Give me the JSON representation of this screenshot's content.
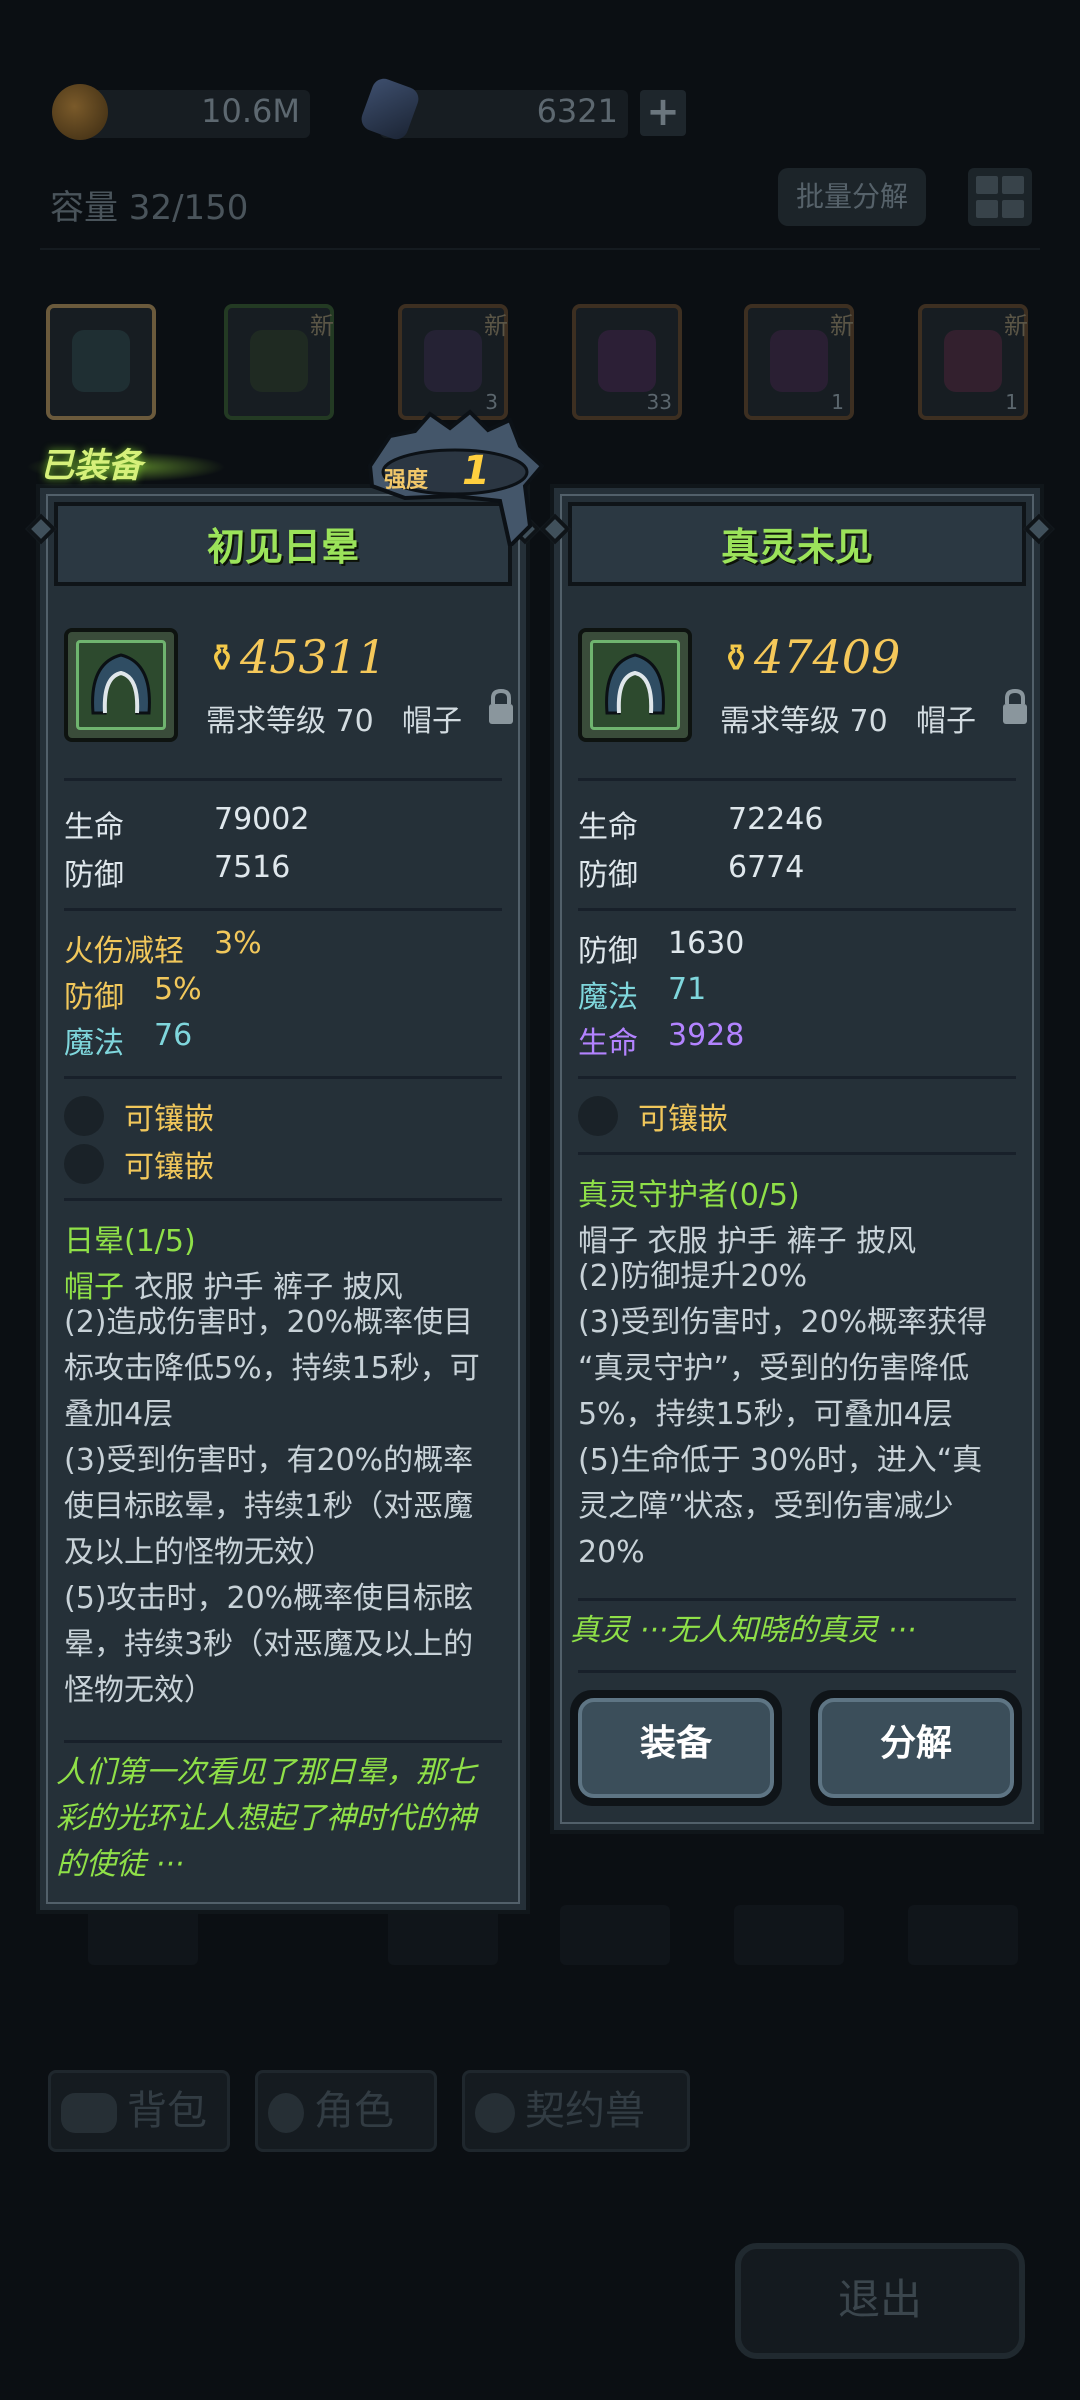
{
  "resources": {
    "gold_value": "10.6M",
    "crystal_value": "6321",
    "plus_label": "+"
  },
  "inventory": {
    "capacity_label": "容量 32/150",
    "batch_decompose_label": "批量分解",
    "slot_new_label": "新",
    "slot_counts": [
      "3",
      "33",
      "1",
      "1"
    ]
  },
  "bottom_tabs": {
    "bag": "背包",
    "character": "角色",
    "pet": "契约兽"
  },
  "exit_label": "退出",
  "equipped_badge": "已装备",
  "strength": {
    "label": "强度",
    "value": "1"
  },
  "card_left": {
    "title": "初见日晕",
    "power": "45311",
    "req_level": "需求等级 70",
    "slot_type": "帽子",
    "base_stats": [
      {
        "name": "生命",
        "value": "79002"
      },
      {
        "name": "防御",
        "value": "7516"
      }
    ],
    "extra_stats": [
      {
        "name": "火伤减轻",
        "value": "3%"
      },
      {
        "name": "防御",
        "value": "5%"
      },
      {
        "name": "魔法",
        "value": "76"
      }
    ],
    "sockets": [
      "可镶嵌",
      "可镶嵌"
    ],
    "set_name": "日晕(1/5)",
    "set_pieces_active": "帽子",
    "set_pieces_rest": "衣服 护手 裤子 披风",
    "set_desc": "(2)造成伤害时，20%概率使目\n标攻击降低5%，持续15秒，可\n叠加4层\n(3)受到伤害时，有20%的概率\n使目标眩晕，持续1秒（对恶魔\n及以上的怪物无效）\n(5)攻击时，20%概率使目标眩\n晕，持续3秒（对恶魔及以上的\n怪物无效）",
    "flavor_line1": "人们第一次看见了那日晕，那七",
    "flavor_line2": "彩的光环让人想起了神时代的神",
    "flavor_line3": "的使徒 ···"
  },
  "card_right": {
    "title": "真灵未见",
    "power": "47409",
    "req_level": "需求等级 70",
    "slot_type": "帽子",
    "base_stats": [
      {
        "name": "生命",
        "value": "72246"
      },
      {
        "name": "防御",
        "value": "6774"
      }
    ],
    "extra_stats": [
      {
        "name": "防御",
        "value": "1630"
      },
      {
        "name": "魔法",
        "value": "71"
      },
      {
        "name": "生命",
        "value": "3928"
      }
    ],
    "sockets": [
      "可镶嵌"
    ],
    "set_name": "真灵守护者(0/5)",
    "set_pieces": "帽子 衣服 护手 裤子 披风",
    "set_desc": "(2)防御提升20%\n(3)受到伤害时，20%概率获得\n“真灵守护”，受到的伤害降低\n5%，持续15秒，可叠加4层\n(5)生命低于 30%时，进入“真\n灵之障”状态，受到伤害减少\n20%",
    "flavor": "真灵 ···无人知晓的真灵 ···",
    "equip_button": "装备",
    "decompose_button": "分解"
  }
}
